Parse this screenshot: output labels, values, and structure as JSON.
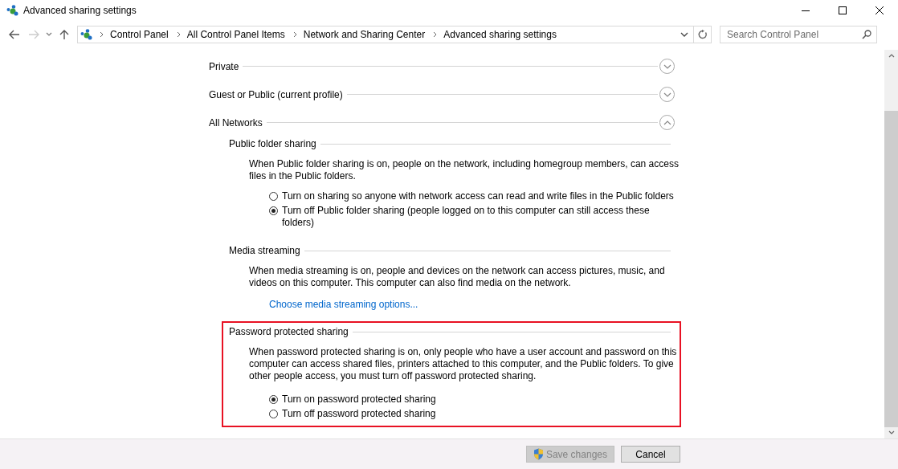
{
  "window": {
    "title": "Advanced sharing settings"
  },
  "address_bar": {
    "breadcrumbs": [
      "Control Panel",
      "All Control Panel Items",
      "Network and Sharing Center",
      "Advanced sharing settings"
    ]
  },
  "search": {
    "placeholder": "Search Control Panel"
  },
  "profiles": [
    {
      "title": "Private",
      "expanded": false
    },
    {
      "title": "Guest or Public (current profile)",
      "expanded": false
    },
    {
      "title": "All Networks",
      "expanded": true,
      "sections": [
        {
          "title": "Public folder sharing",
          "highlighted": false,
          "description": "When Public folder sharing is on, people on the network, including homegroup members, can access files in the Public folders.",
          "options": [
            {
              "label": "Turn on sharing so anyone with network access can read and write files in the Public folders",
              "selected": false
            },
            {
              "label": "Turn off Public folder sharing (people logged on to this computer can still access these folders)",
              "selected": true
            }
          ]
        },
        {
          "title": "Media streaming",
          "highlighted": false,
          "description": "When media streaming is on, people and devices on the network can access pictures, music, and videos on this computer. This computer can also find media on the network.",
          "link": "Choose media streaming options..."
        },
        {
          "title": "Password protected sharing",
          "highlighted": true,
          "description": "When password protected sharing is on, only people who have a user account and password on this computer can access shared files, printers attached to this computer, and the Public folders. To give other people access, you must turn off password protected sharing.",
          "options": [
            {
              "label": "Turn on password protected sharing",
              "selected": true
            },
            {
              "label": "Turn off password protected sharing",
              "selected": false
            }
          ]
        }
      ]
    }
  ],
  "buttons": [
    {
      "label": "Save changes",
      "disabled": true
    },
    {
      "label": "Cancel",
      "disabled": false
    }
  ]
}
